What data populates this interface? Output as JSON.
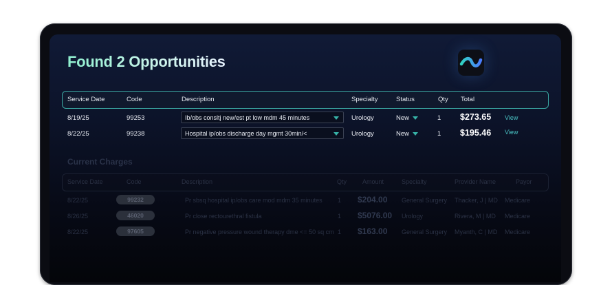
{
  "opportunities": {
    "title": "Found 2 Opportunities",
    "columns": {
      "service_date": "Service Date",
      "code": "Code",
      "description": "Description",
      "specialty": "Specialty",
      "status": "Status",
      "qty": "Qty",
      "total": "Total"
    },
    "rows": [
      {
        "service_date": "8/19/25",
        "code": "99253",
        "description": "Ib/obs consltj new/est pt low mdm 45 minutes",
        "specialty": "Urology",
        "status": "New",
        "qty": "1",
        "total": "$273.65",
        "action": "View"
      },
      {
        "service_date": "8/22/25",
        "code": "99238",
        "description": "Hospital ip/obs discharge day mgmt 30min/<",
        "specialty": "Urology",
        "status": "New",
        "qty": "1",
        "total": "$195.46",
        "action": "View"
      }
    ]
  },
  "current_charges": {
    "title": "Current Charges",
    "columns": {
      "service_date": "Service Date",
      "code": "Code",
      "description": "Description",
      "qty": "Qty",
      "amount": "Amount",
      "specialty": "Specialty",
      "provider": "Provider Name",
      "payor": "Payor"
    },
    "rows": [
      {
        "service_date": "8/22/25",
        "code": "99232",
        "description": "Pr sbsq hospital ip/obs care mod mdm 35 minutes",
        "qty": "1",
        "amount": "$204.00",
        "specialty": "General Surgery",
        "provider": "Thacker, J | MD",
        "payor": "Medicare"
      },
      {
        "service_date": "8/26/25",
        "code": "46020",
        "description": "Pr close rectourethral fistula",
        "qty": "1",
        "amount": "$5076.00",
        "specialty": "Urology",
        "provider": "Rivera, M | MD",
        "payor": "Medicare"
      },
      {
        "service_date": "8/22/25",
        "code": "97605",
        "description": "Pr negative pressure wound therapy dme <= 50 sq cm",
        "qty": "1",
        "amount": "$163.00",
        "specialty": "General Surgery",
        "provider": "Myanth, C | MD",
        "payor": "Medicare"
      }
    ]
  },
  "icons": {
    "logo": "wave-logo-icon",
    "dropdown": "caret-down-icon"
  },
  "colors": {
    "accent": "#37b3a8",
    "link": "#49c3c4",
    "title_gradient_start": "#8ef0cf",
    "background": "#0c1329"
  }
}
